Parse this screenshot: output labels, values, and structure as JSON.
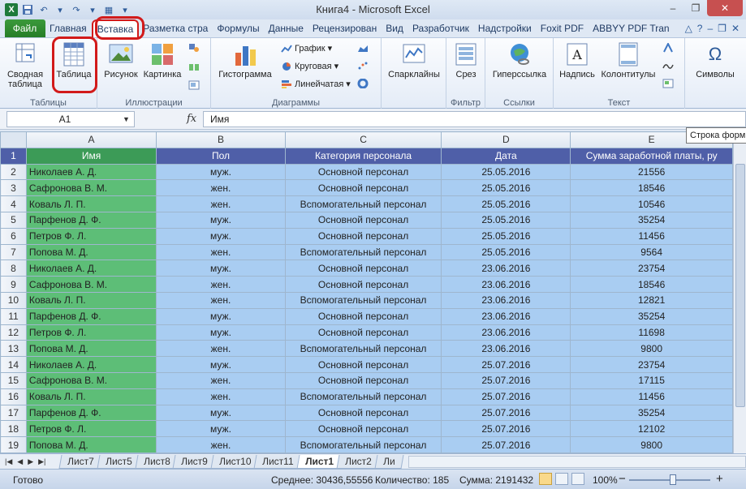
{
  "window": {
    "title": "Книга4  -  Microsoft Excel",
    "min": "–",
    "max": "❐",
    "close": "✕"
  },
  "ribbon_tabs": [
    {
      "label": "Файл"
    },
    {
      "label": "Главная"
    },
    {
      "label": "Вставка"
    },
    {
      "label": "Разметка стра"
    },
    {
      "label": "Формулы"
    },
    {
      "label": "Данные"
    },
    {
      "label": "Рецензирован"
    },
    {
      "label": "Вид"
    },
    {
      "label": "Разработчик"
    },
    {
      "label": "Надстройки"
    },
    {
      "label": "Foxit PDF"
    },
    {
      "label": "ABBYY PDF Tran"
    }
  ],
  "ribbon": {
    "tables": {
      "label": "Таблицы",
      "pivot_line1": "Сводная",
      "pivot_line2": "таблица",
      "table": "Таблица"
    },
    "illustrations": {
      "label": "Иллюстрации",
      "picture": "Рисунок",
      "clipart": "Картинка"
    },
    "charts": {
      "label": "Диаграммы",
      "histogram": "Гистограмма",
      "line": "График",
      "pie": "Круговая",
      "bar": "Линейчатая"
    },
    "sparklines": {
      "label": "",
      "button": "Спарклайны"
    },
    "filter": {
      "label": "Фильтр",
      "button": "Срез"
    },
    "links": {
      "label": "Ссылки",
      "button": "Гиперссылка"
    },
    "text": {
      "label": "Текст",
      "textbox": "Надпись",
      "headerfooter": "Колонтитулы"
    },
    "symbols": {
      "button": "Символы",
      "glyph": "Ω"
    }
  },
  "formula_bar": {
    "name_box": "A1",
    "fx": "fx",
    "value": "Имя",
    "tooltip": "Строка форм"
  },
  "columns": [
    "A",
    "B",
    "C",
    "D",
    "E"
  ],
  "header_row": [
    "Имя",
    "Пол",
    "Категория персонала",
    "Дата",
    "Сумма заработной платы, ру"
  ],
  "rows": [
    [
      "Николаев А. Д.",
      "муж.",
      "Основной персонал",
      "25.05.2016",
      "21556"
    ],
    [
      "Сафронова В. М.",
      "жен.",
      "Основной персонал",
      "25.05.2016",
      "18546"
    ],
    [
      "Коваль Л. П.",
      "жен.",
      "Вспомогательный персонал",
      "25.05.2016",
      "10546"
    ],
    [
      "Парфенов Д. Ф.",
      "муж.",
      "Основной персонал",
      "25.05.2016",
      "35254"
    ],
    [
      "Петров Ф. Л.",
      "муж.",
      "Основной персонал",
      "25.05.2016",
      "11456"
    ],
    [
      "Попова М. Д.",
      "жен.",
      "Вспомогательный персонал",
      "25.05.2016",
      "9564"
    ],
    [
      "Николаев А. Д.",
      "муж.",
      "Основной персонал",
      "23.06.2016",
      "23754"
    ],
    [
      "Сафронова В. М.",
      "жен.",
      "Основной персонал",
      "23.06.2016",
      "18546"
    ],
    [
      "Коваль Л. П.",
      "жен.",
      "Вспомогательный персонал",
      "23.06.2016",
      "12821"
    ],
    [
      "Парфенов Д. Ф.",
      "муж.",
      "Основной персонал",
      "23.06.2016",
      "35254"
    ],
    [
      "Петров Ф. Л.",
      "муж.",
      "Основной персонал",
      "23.06.2016",
      "11698"
    ],
    [
      "Попова М. Д.",
      "жен.",
      "Вспомогательный персонал",
      "23.06.2016",
      "9800"
    ],
    [
      "Николаев А. Д.",
      "муж.",
      "Основной персонал",
      "25.07.2016",
      "23754"
    ],
    [
      "Сафронова В. М.",
      "жен.",
      "Основной персонал",
      "25.07.2016",
      "17115"
    ],
    [
      "Коваль Л. П.",
      "жен.",
      "Вспомогательный персонал",
      "25.07.2016",
      "11456"
    ],
    [
      "Парфенов Д. Ф.",
      "муж.",
      "Основной персонал",
      "25.07.2016",
      "35254"
    ],
    [
      "Петров Ф. Л.",
      "муж.",
      "Основной персонал",
      "25.07.2016",
      "12102"
    ],
    [
      "Попова М. Д.",
      "жен.",
      "Вспомогательный персонал",
      "25.07.2016",
      "9800"
    ]
  ],
  "sheet_tabs": [
    "Лист7",
    "Лист5",
    "Лист8",
    "Лист9",
    "Лист10",
    "Лист11",
    "Лист1",
    "Лист2",
    "Ли"
  ],
  "active_sheet": "Лист1",
  "status": {
    "ready": "Готово",
    "average": "Среднее: 30436,55556",
    "count": "Количество: 185",
    "sum": "Сумма: 2191432",
    "zoom": "100%",
    "zoom_minus": "−",
    "zoom_plus": "+"
  },
  "colors": {
    "file_tab": "#2f8f2f",
    "highlight": "#d21a1a",
    "header_fill": "#4f5fa8",
    "name_col_fill": "#5dbe77",
    "data_fill": "#a9cdf2"
  }
}
